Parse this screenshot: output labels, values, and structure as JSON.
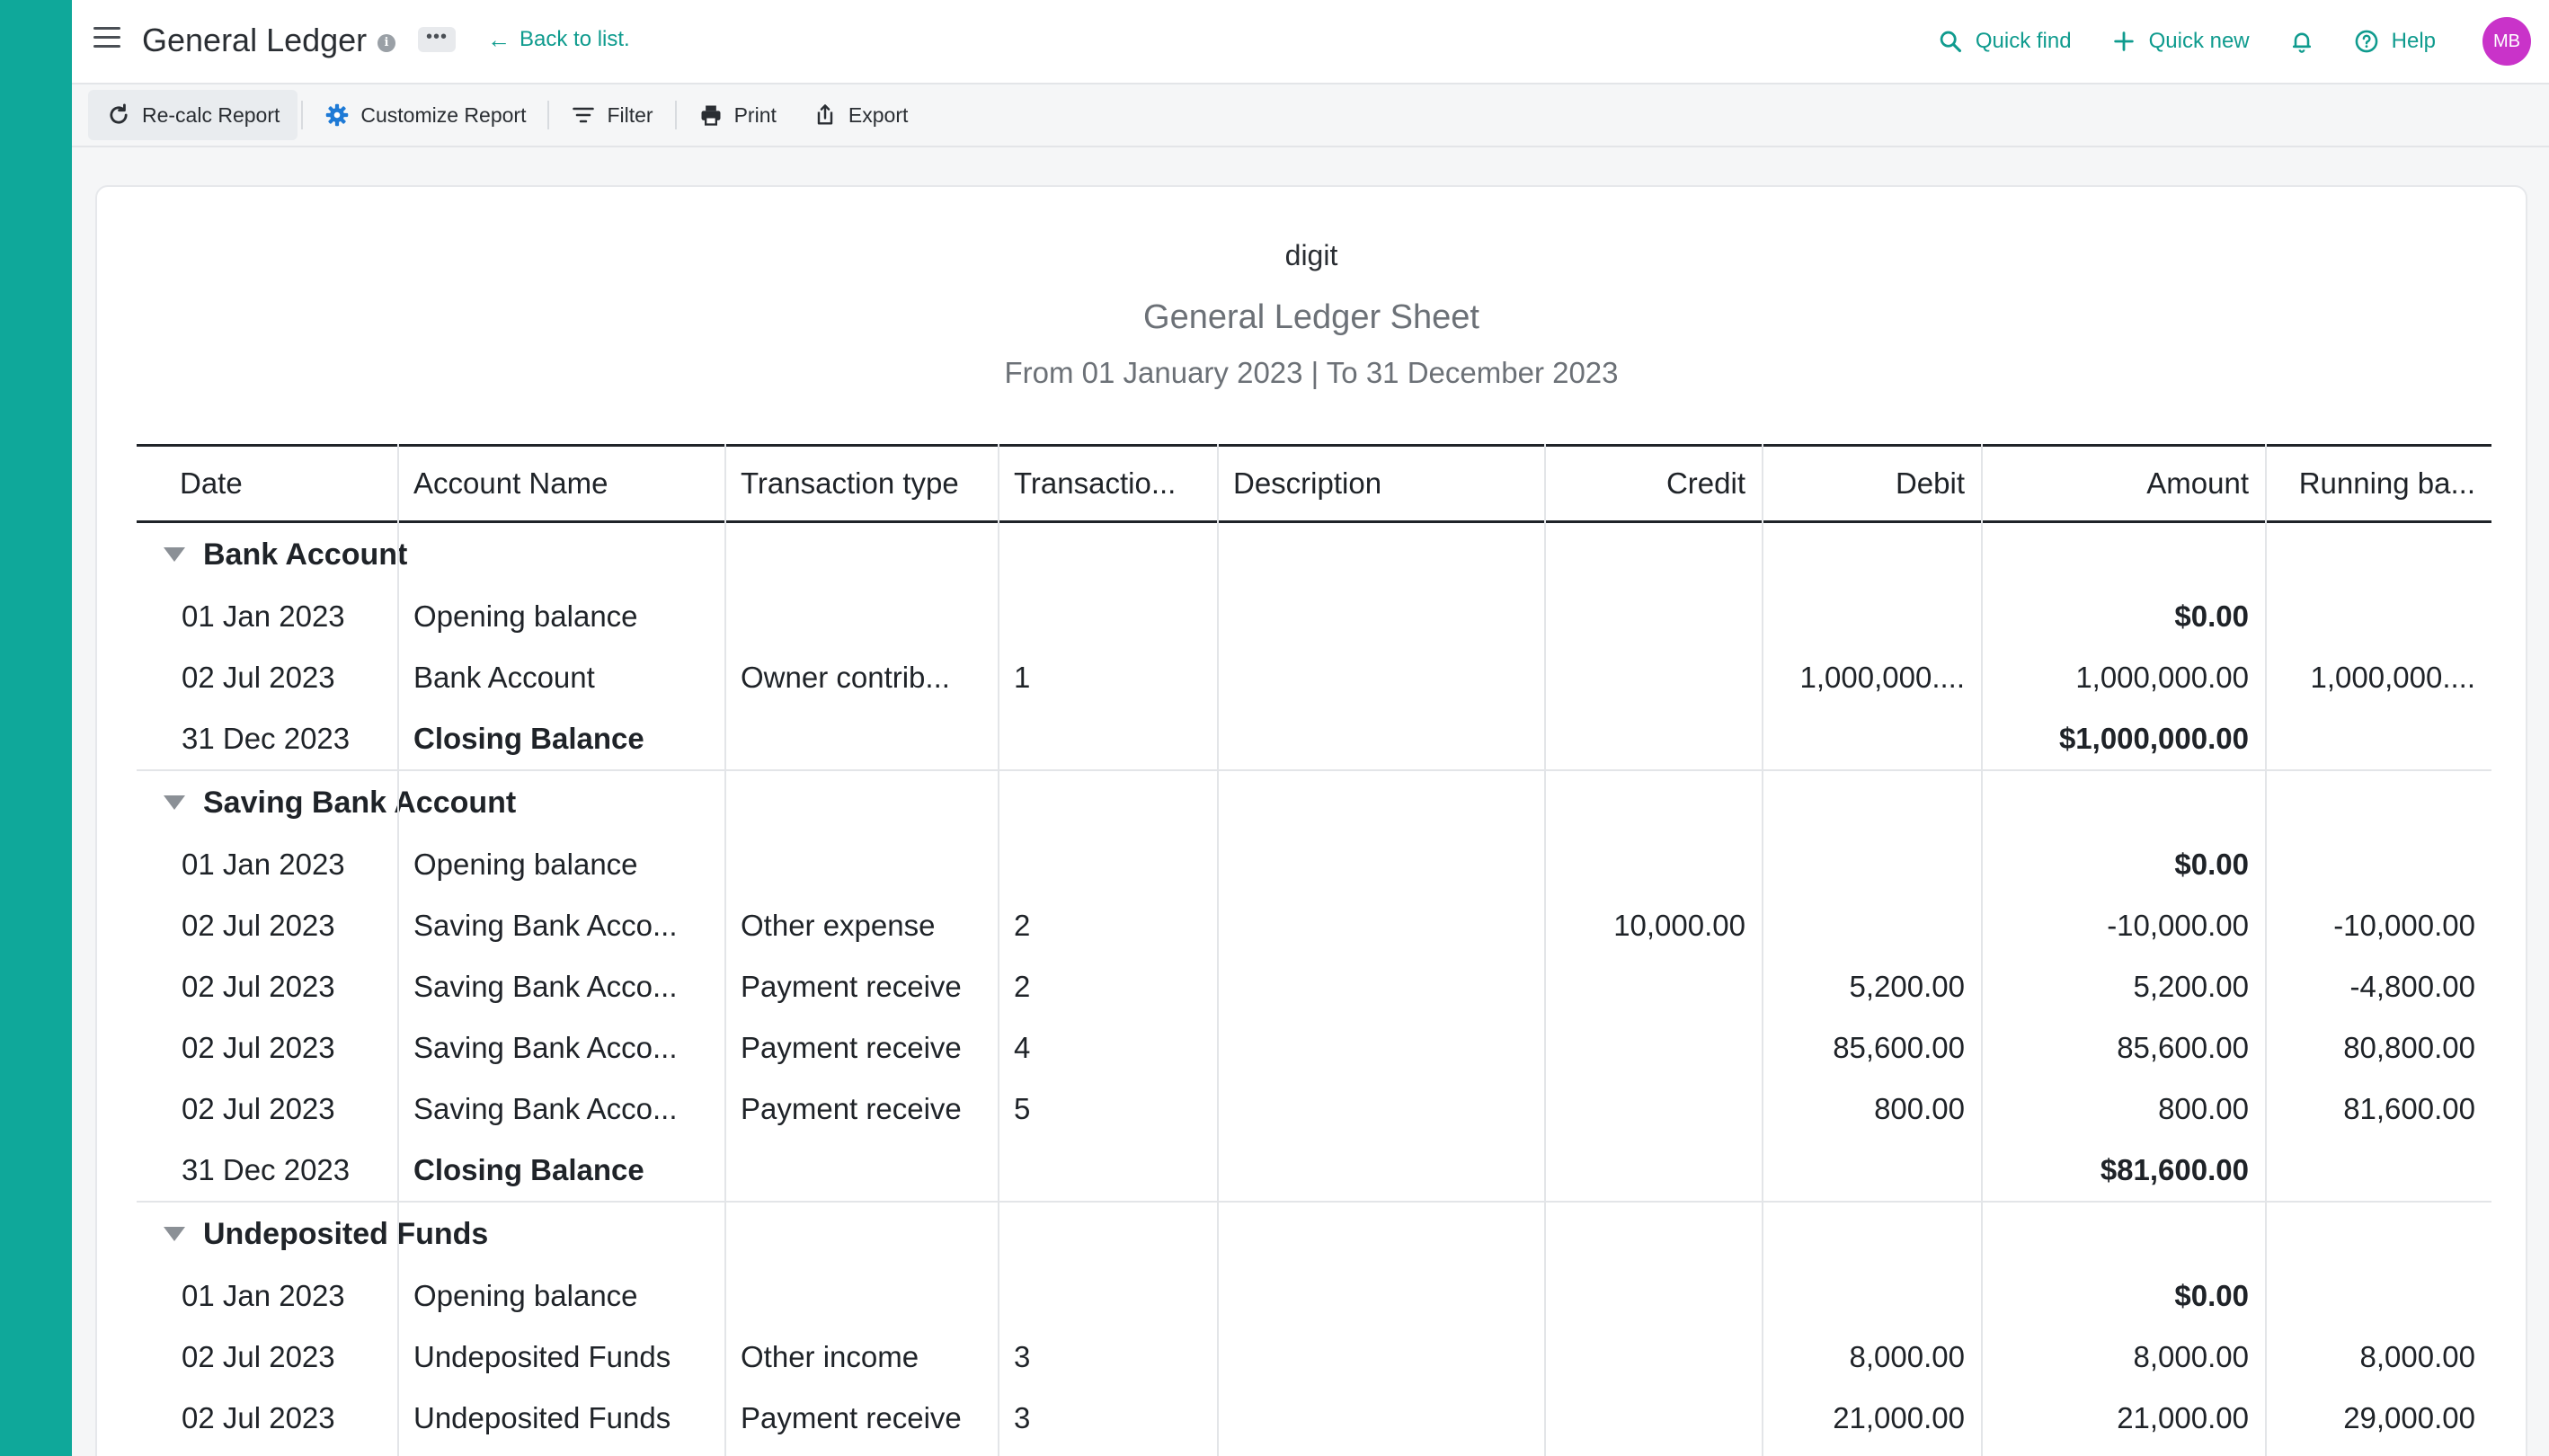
{
  "header": {
    "title": "General Ledger",
    "back_label": "Back to list.",
    "more_label": "•••",
    "info_label": "i",
    "quick_find": "Quick find",
    "quick_new": "Quick new",
    "help": "Help",
    "avatar_initials": "MB"
  },
  "toolbar": {
    "recalc": "Re-calc Report",
    "customize": "Customize Report",
    "filter": "Filter",
    "print": "Print",
    "export": "Export"
  },
  "report": {
    "org": "digit",
    "title": "General Ledger Sheet",
    "period": "From 01 January 2023 | To 31 December 2023"
  },
  "table": {
    "columns": [
      "Date",
      "Account Name",
      "Transaction type",
      "Transactio...",
      "Description",
      "Credit",
      "Debit",
      "Amount",
      "Running ba..."
    ],
    "groups": [
      {
        "name": "Bank Account",
        "rows": [
          [
            "01 Jan 2023",
            "Opening balance",
            "",
            "",
            "",
            "",
            "",
            "$0.00",
            ""
          ],
          [
            "02 Jul 2023",
            "Bank Account",
            "Owner contrib...",
            "1",
            "",
            "",
            "1,000,000....",
            "1,000,000.00",
            "1,000,000...."
          ],
          [
            "31 Dec 2023",
            "Closing Balance",
            "",
            "",
            "",
            "",
            "",
            "$1,000,000.00",
            ""
          ]
        ]
      },
      {
        "name": "Saving Bank Account",
        "rows": [
          [
            "01 Jan 2023",
            "Opening balance",
            "",
            "",
            "",
            "",
            "",
            "$0.00",
            ""
          ],
          [
            "02 Jul 2023",
            "Saving Bank Acco...",
            "Other expense",
            "2",
            "",
            "10,000.00",
            "",
            "-10,000.00",
            "-10,000.00"
          ],
          [
            "02 Jul 2023",
            "Saving Bank Acco...",
            "Payment receive",
            "2",
            "",
            "",
            "5,200.00",
            "5,200.00",
            "-4,800.00"
          ],
          [
            "02 Jul 2023",
            "Saving Bank Acco...",
            "Payment receive",
            "4",
            "",
            "",
            "85,600.00",
            "85,600.00",
            "80,800.00"
          ],
          [
            "02 Jul 2023",
            "Saving Bank Acco...",
            "Payment receive",
            "5",
            "",
            "",
            "800.00",
            "800.00",
            "81,600.00"
          ],
          [
            "31 Dec 2023",
            "Closing Balance",
            "",
            "",
            "",
            "",
            "",
            "$81,600.00",
            ""
          ]
        ]
      },
      {
        "name": "Undeposited Funds",
        "rows": [
          [
            "01 Jan 2023",
            "Opening balance",
            "",
            "",
            "",
            "",
            "",
            "$0.00",
            ""
          ],
          [
            "02 Jul 2023",
            "Undeposited Funds",
            "Other income",
            "3",
            "",
            "",
            "8,000.00",
            "8,000.00",
            "8,000.00"
          ],
          [
            "02 Jul 2023",
            "Undeposited Funds",
            "Payment receive",
            "3",
            "",
            "",
            "21,000.00",
            "21,000.00",
            "29,000.00"
          ]
        ]
      }
    ]
  },
  "colors": {
    "accent": "#0fa89a",
    "link": "#0f9b8e",
    "avatar": "#c933c9"
  }
}
